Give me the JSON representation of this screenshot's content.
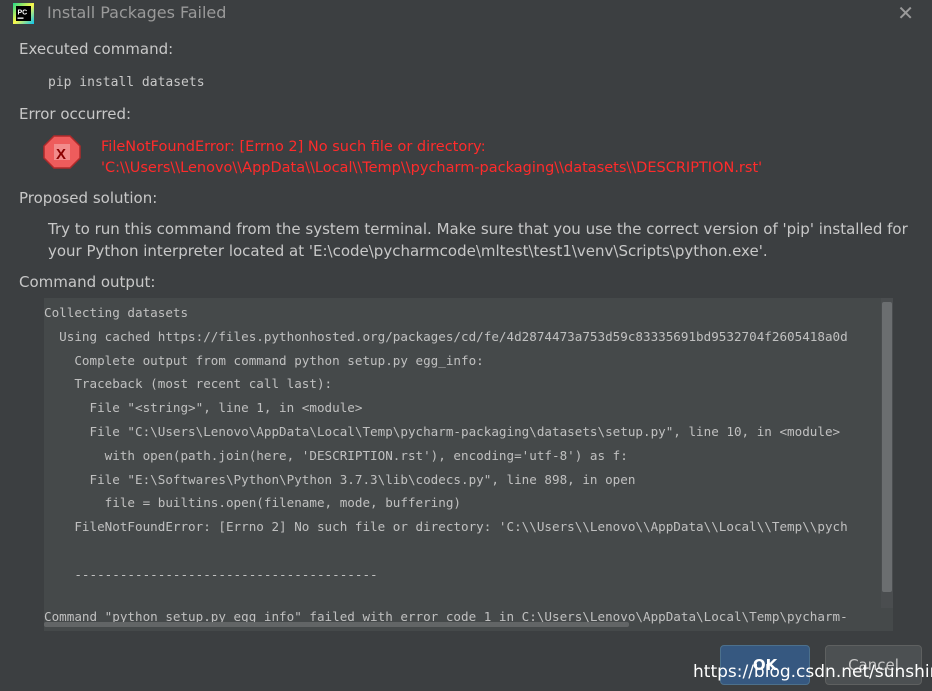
{
  "window": {
    "title": "Install Packages Failed"
  },
  "sections": {
    "executed_label": "Executed command:",
    "command": "pip install datasets",
    "error_label": "Error occurred:",
    "error_lines": [
      "FileNotFoundError: [Errno 2] No such file or directory:",
      "'C:\\\\Users\\\\Lenovo\\\\AppData\\\\Local\\\\Temp\\\\pycharm-packaging\\\\datasets\\\\DESCRIPTION.rst'"
    ],
    "solution_label": "Proposed solution:",
    "solution_text": "Try to run this command from the system terminal. Make sure that you use the correct version of 'pip' installed for your Python interpreter located at 'E:\\code\\pycharmcode\\mltest\\test1\\venv\\Scripts\\python.exe'.",
    "output_label": "Command output:"
  },
  "output_lines": [
    "Collecting datasets",
    "  Using cached https://files.pythonhosted.org/packages/cd/fe/4d2874473a753d59c83335691bd9532704f2605418a0d",
    "    Complete output from command python setup.py egg_info:",
    "    Traceback (most recent call last):",
    "      File \"<string>\", line 1, in <module>",
    "      File \"C:\\Users\\Lenovo\\AppData\\Local\\Temp\\pycharm-packaging\\datasets\\setup.py\", line 10, in <module>",
    "        with open(path.join(here, 'DESCRIPTION.rst'), encoding='utf-8') as f:",
    "      File \"E:\\Softwares\\Python\\Python 3.7.3\\lib\\codecs.py\", line 898, in open",
    "        file = builtins.open(filename, mode, buffering)",
    "    FileNotFoundError: [Errno 2] No such file or directory: 'C:\\\\Users\\\\Lenovo\\\\AppData\\\\Local\\\\Temp\\\\pych",
    "",
    "    ----------------------------------------"
  ],
  "output_footer": "Command \"python setup.py egg_info\" failed with error code 1 in C:\\Users\\Lenovo\\AppData\\Local\\Temp\\pycharm-",
  "buttons": {
    "ok": "OK",
    "cancel": "Cancel"
  },
  "watermark": "https://blog.csdn.net/sunshine04",
  "colors": {
    "background": "#3c3f41",
    "error": "#ff2b2b",
    "primary_button": "#365880"
  },
  "icons": {
    "app": "pycharm-icon",
    "error": "error-x-icon",
    "close": "close-icon"
  }
}
